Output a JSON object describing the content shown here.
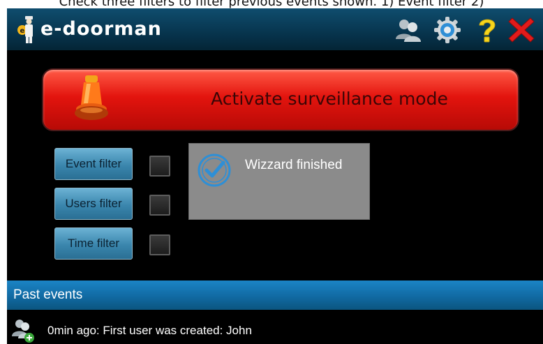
{
  "caption": "Check three filters to filter previous events shown. 1) Event filter 2)",
  "app": {
    "title": "e-doorman"
  },
  "toolbar_icons": [
    "users-icon",
    "settings-gear-icon",
    "help-icon",
    "close-icon"
  ],
  "activate": {
    "label": "Activate surveillance mode"
  },
  "filters": [
    {
      "label": "Event filter",
      "checked": false
    },
    {
      "label": "Users filter",
      "checked": false
    },
    {
      "label": "Time filter",
      "checked": false
    }
  ],
  "notification": {
    "text": "Wizzard finished"
  },
  "past_events": {
    "title": "Past events",
    "items": [
      {
        "text": "0min ago: First user was created: John",
        "icon": "user-add-icon"
      }
    ]
  },
  "colors": {
    "topbar": "#07344d",
    "activate_red": "#e3140e",
    "filter_blue": "#3a86ad",
    "past_header_blue": "#116aa3",
    "toast_gray": "#8b8b8b",
    "check_blue": "#2e8fd6"
  }
}
